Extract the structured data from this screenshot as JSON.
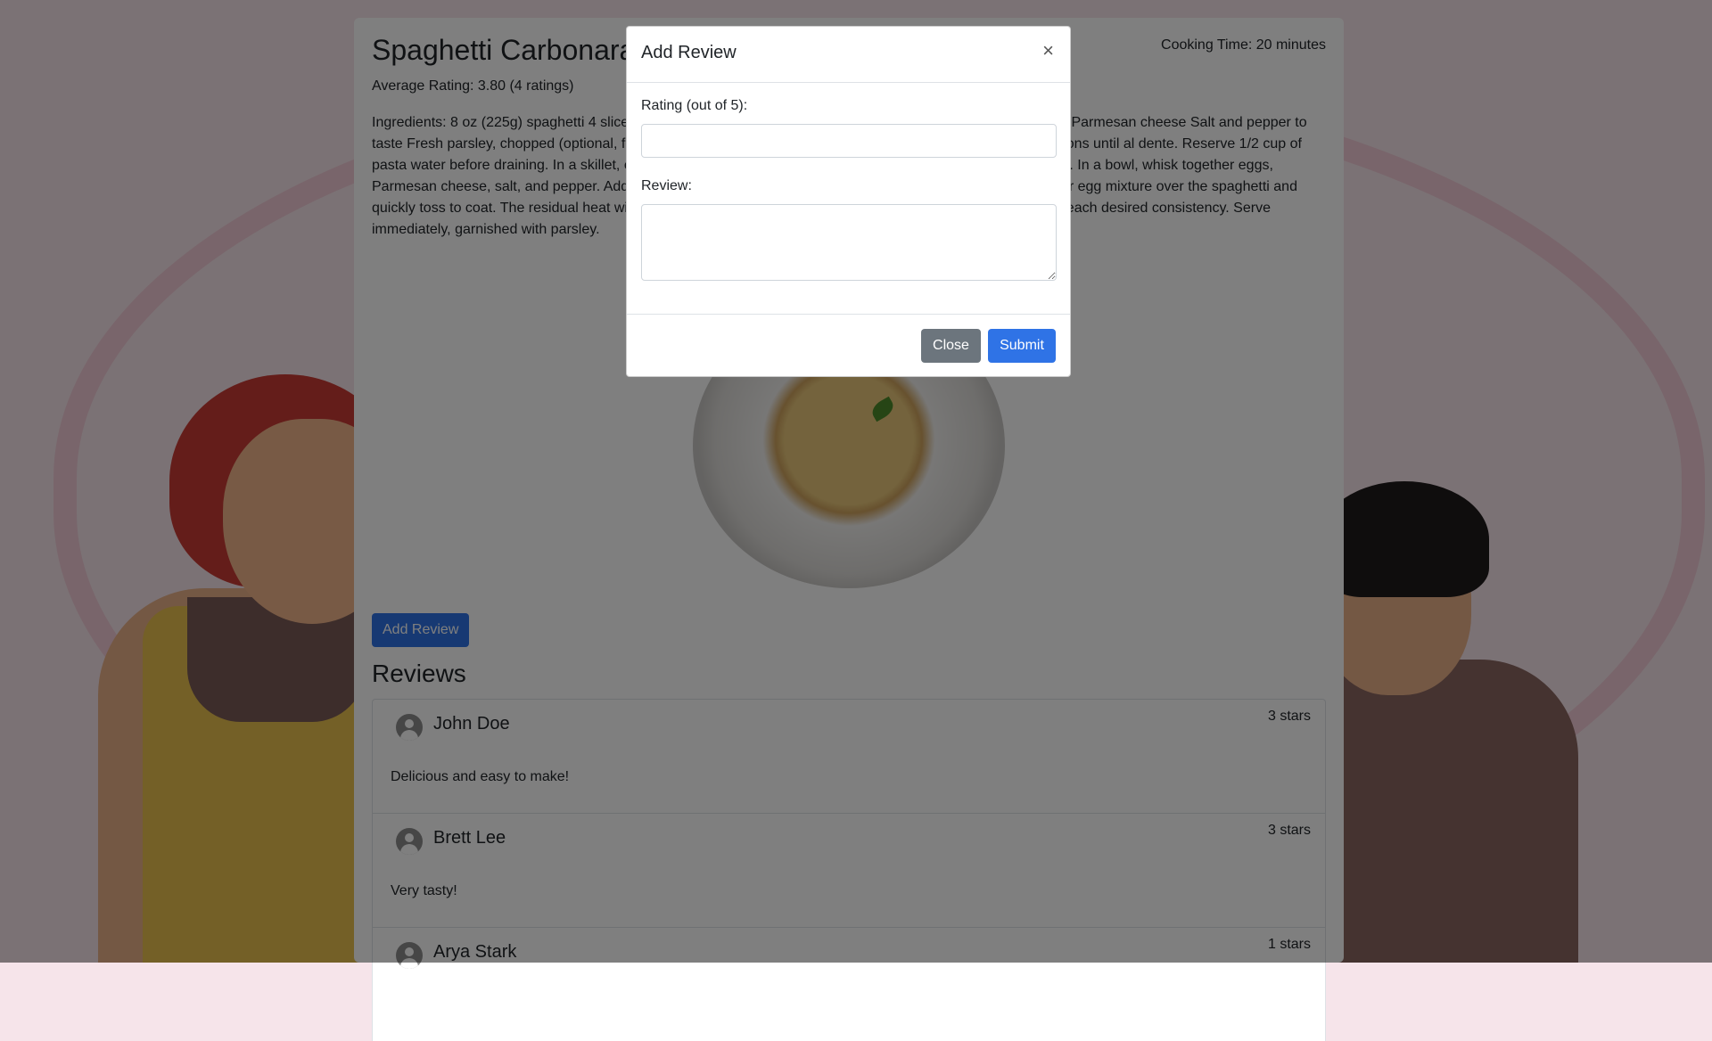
{
  "recipe": {
    "title": "Spaghetti Carbonara",
    "cooking_time": "Cooking Time: 20 minutes",
    "average_rating": "Average Rating: 3.80 (4 ratings)",
    "ingredients_text": "Ingredients: 8 oz (225g) spaghetti 4 slices bacon, chopped 2 cloves garlic, minced 2 large eggs 1/2 cup grated Parmesan cheese Salt and pepper to taste Fresh parsley, chopped (optional, for garnish) Instructions: Cook spaghetti according to package instructions until al dente. Reserve 1/2 cup of pasta water before draining. In a skillet, cook bacon until crispy. Add minced garlic and cook for another minute. In a bowl, whisk together eggs, Parmesan cheese, salt, and pepper. Add cooked spaghetti to the skillet with bacon and remove from heat. Pour egg mixture over the spaghetti and quickly toss to coat. The residual heat will cook the eggs. If needed, add some of the reserved pasta water to reach desired consistency. Serve immediately, garnished with parsley."
  },
  "actions": {
    "add_review_label": "Add Review"
  },
  "reviews": {
    "heading": "Reviews",
    "items": [
      {
        "name": "John Doe",
        "stars": "3 stars",
        "text": "Delicious and easy to make!"
      },
      {
        "name": "Brett Lee",
        "stars": "3 stars",
        "text": "Very tasty!"
      },
      {
        "name": "Arya Stark",
        "stars": "1 stars",
        "text": ""
      }
    ]
  },
  "modal": {
    "title": "Add Review",
    "close_symbol": "×",
    "rating_label": "Rating (out of 5):",
    "rating_value": "",
    "review_label": "Review:",
    "review_value": "",
    "close_button": "Close",
    "submit_button": "Submit"
  },
  "colors": {
    "primary": "#2f73e6",
    "secondary": "#6c757d",
    "backdrop": "rgba(0,0,0,0.5)"
  }
}
